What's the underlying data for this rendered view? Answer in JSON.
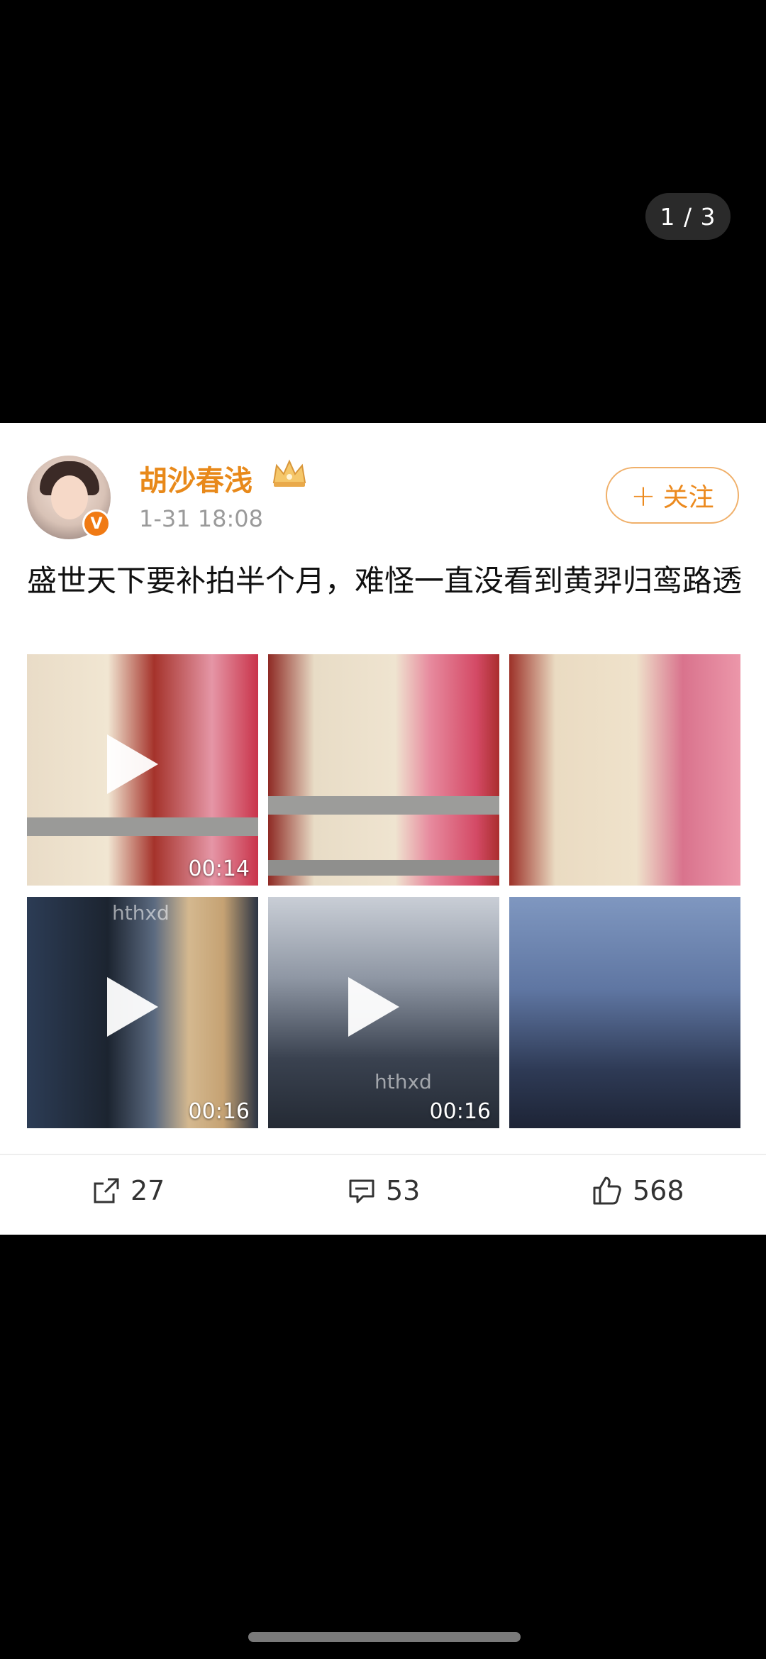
{
  "viewer": {
    "counter": "1 / 3"
  },
  "post": {
    "author": "胡沙春浅",
    "time": "1-31 18:08",
    "follow_label": "关注",
    "text": "盛世天下要补拍半个月，难怪一直没看到黄羿归鸾路透",
    "verified_badge": "V",
    "media": [
      {
        "type": "video",
        "duration": "00:14",
        "watermark": ""
      },
      {
        "type": "image",
        "duration": "",
        "watermark": ""
      },
      {
        "type": "image",
        "duration": "",
        "watermark": ""
      },
      {
        "type": "video",
        "duration": "00:16",
        "watermark": "hthxd"
      },
      {
        "type": "video",
        "duration": "00:16",
        "watermark": "hthxd"
      },
      {
        "type": "image",
        "duration": "",
        "watermark": ""
      }
    ],
    "stats": {
      "reposts": "27",
      "comments": "53",
      "likes": "568"
    }
  },
  "colors": {
    "accent": "#e8891a",
    "background": "#000000",
    "card": "#ffffff"
  }
}
